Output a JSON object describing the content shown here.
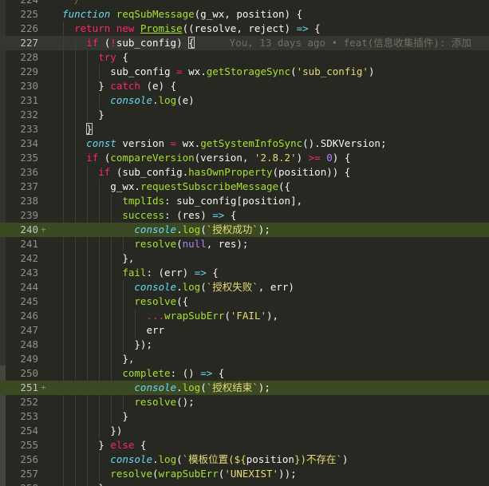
{
  "editor": {
    "blame_text": "You, 13 days ago • feat(信息收集插件): 添加",
    "colors": {
      "background": "#272822",
      "added_line": "#3b4a22",
      "keyword": "#f92672",
      "storage": "#66d9ef",
      "function_name": "#a6e22e",
      "string": "#e6db74",
      "number": "#ae81ff",
      "comment": "#75715e"
    },
    "lines": [
      {
        "num": "224",
        "indent": 2,
        "marker": "",
        "toks": [
          [
            "m",
            " */"
          ]
        ]
      },
      {
        "num": "225",
        "indent": 2,
        "marker": "",
        "toks": [
          [
            "c",
            "function"
          ],
          [
            "",
            " "
          ],
          [
            "f",
            "reqSubMessage"
          ],
          [
            "",
            "(g_wx, position) {"
          ]
        ]
      },
      {
        "num": "226",
        "indent": 4,
        "marker": "",
        "toks": [
          [
            "k",
            "return"
          ],
          [
            "",
            " "
          ],
          [
            "k",
            "new"
          ],
          [
            "",
            " "
          ],
          [
            "fu",
            "Promise"
          ],
          [
            "",
            "((resolve, reject) "
          ],
          [
            "c",
            "=>"
          ],
          [
            "",
            " {"
          ]
        ]
      },
      {
        "num": "227",
        "indent": 6,
        "marker": "",
        "cls": "cur",
        "blame": true,
        "toks": [
          [
            "k",
            "if"
          ],
          [
            "",
            " ("
          ],
          [
            "k",
            "!"
          ],
          [
            "",
            "sub_config) "
          ],
          [
            "bx",
            "{"
          ]
        ]
      },
      {
        "num": "228",
        "indent": 8,
        "marker": "",
        "toks": [
          [
            "k",
            "try"
          ],
          [
            "",
            " {"
          ]
        ]
      },
      {
        "num": "229",
        "indent": 10,
        "marker": "",
        "toks": [
          [
            "",
            "sub_config "
          ],
          [
            "k",
            "="
          ],
          [
            "",
            " wx."
          ],
          [
            "f",
            "getStorageSync"
          ],
          [
            "",
            "("
          ],
          [
            "t",
            "'sub_config'"
          ],
          [
            "",
            ")"
          ]
        ]
      },
      {
        "num": "230",
        "indent": 8,
        "marker": "",
        "toks": [
          [
            "",
            "} "
          ],
          [
            "k",
            "catch"
          ],
          [
            "",
            " (e) {"
          ]
        ]
      },
      {
        "num": "231",
        "indent": 10,
        "marker": "",
        "toks": [
          [
            "c",
            "console"
          ],
          [
            "",
            "."
          ],
          [
            "f",
            "log"
          ],
          [
            "",
            "(e)"
          ]
        ]
      },
      {
        "num": "232",
        "indent": 8,
        "marker": "",
        "toks": [
          [
            "",
            "}"
          ]
        ]
      },
      {
        "num": "233",
        "indent": 6,
        "marker": "",
        "toks": [
          [
            "bx",
            "}"
          ]
        ]
      },
      {
        "num": "234",
        "indent": 6,
        "marker": "",
        "toks": [
          [
            "c",
            "const"
          ],
          [
            "",
            " version "
          ],
          [
            "k",
            "="
          ],
          [
            "",
            " wx."
          ],
          [
            "f",
            "getSystemInfoSync"
          ],
          [
            "",
            "().SDKVersion;"
          ]
        ]
      },
      {
        "num": "235",
        "indent": 6,
        "marker": "",
        "toks": [
          [
            "k",
            "if"
          ],
          [
            "",
            " ("
          ],
          [
            "f",
            "compareVersion"
          ],
          [
            "",
            "(version, "
          ],
          [
            "t",
            "'2.8.2'"
          ],
          [
            "",
            ") "
          ],
          [
            "k",
            ">="
          ],
          [
            "",
            " "
          ],
          [
            "n",
            "0"
          ],
          [
            "",
            ") {"
          ]
        ]
      },
      {
        "num": "236",
        "indent": 8,
        "marker": "",
        "toks": [
          [
            "k",
            "if"
          ],
          [
            "",
            " (sub_config."
          ],
          [
            "f",
            "hasOwnProperty"
          ],
          [
            "",
            "(position)) {"
          ]
        ]
      },
      {
        "num": "237",
        "indent": 10,
        "marker": "",
        "toks": [
          [
            "",
            "g_wx."
          ],
          [
            "f",
            "requestSubscribeMessage"
          ],
          [
            "",
            "({"
          ]
        ]
      },
      {
        "num": "238",
        "indent": 12,
        "marker": "",
        "toks": [
          [
            "f",
            "tmplIds"
          ],
          [
            "",
            ": sub_config[position],"
          ]
        ]
      },
      {
        "num": "239",
        "indent": 12,
        "marker": "",
        "toks": [
          [
            "f",
            "success"
          ],
          [
            "",
            ": (res) "
          ],
          [
            "c",
            "=>"
          ],
          [
            "",
            " {"
          ]
        ]
      },
      {
        "num": "240",
        "indent": 14,
        "marker": "+",
        "cls": "hl",
        "toks": [
          [
            "c",
            "console"
          ],
          [
            "",
            "."
          ],
          [
            "f",
            "log"
          ],
          [
            "",
            "("
          ],
          [
            "t",
            "`授权成功`"
          ],
          [
            "",
            ");"
          ]
        ]
      },
      {
        "num": "241",
        "indent": 14,
        "marker": "",
        "toks": [
          [
            "f",
            "resolve"
          ],
          [
            "",
            "("
          ],
          [
            "n",
            "null"
          ],
          [
            "",
            ", res);"
          ]
        ]
      },
      {
        "num": "242",
        "indent": 12,
        "marker": "",
        "toks": [
          [
            "",
            "},"
          ]
        ]
      },
      {
        "num": "243",
        "indent": 12,
        "marker": "",
        "toks": [
          [
            "f",
            "fail"
          ],
          [
            "",
            ": (err) "
          ],
          [
            "c",
            "=>"
          ],
          [
            "",
            " {"
          ]
        ]
      },
      {
        "num": "244",
        "indent": 14,
        "marker": "",
        "toks": [
          [
            "c",
            "console"
          ],
          [
            "",
            "."
          ],
          [
            "f",
            "log"
          ],
          [
            "",
            "("
          ],
          [
            "t",
            "`授权失败`"
          ],
          [
            "",
            ", err)"
          ]
        ]
      },
      {
        "num": "245",
        "indent": 14,
        "marker": "",
        "toks": [
          [
            "f",
            "resolve"
          ],
          [
            "",
            "({"
          ]
        ]
      },
      {
        "num": "246",
        "indent": 16,
        "marker": "",
        "toks": [
          [
            "k",
            "..."
          ],
          [
            "f",
            "wrapSubErr"
          ],
          [
            "",
            "("
          ],
          [
            "t",
            "'FAIL'"
          ],
          [
            "",
            "),"
          ]
        ]
      },
      {
        "num": "247",
        "indent": 16,
        "marker": "",
        "toks": [
          [
            "",
            "err"
          ]
        ]
      },
      {
        "num": "248",
        "indent": 14,
        "marker": "",
        "toks": [
          [
            "",
            "});"
          ]
        ]
      },
      {
        "num": "249",
        "indent": 12,
        "marker": "",
        "toks": [
          [
            "",
            "},"
          ]
        ]
      },
      {
        "num": "250",
        "indent": 12,
        "marker": "",
        "toks": [
          [
            "f",
            "complete"
          ],
          [
            "",
            ": () "
          ],
          [
            "c",
            "=>"
          ],
          [
            "",
            " {"
          ]
        ]
      },
      {
        "num": "251",
        "indent": 14,
        "marker": "+",
        "cls": "hl",
        "toks": [
          [
            "c",
            "console"
          ],
          [
            "",
            "."
          ],
          [
            "f",
            "log"
          ],
          [
            "",
            "("
          ],
          [
            "t",
            "`授权结束`"
          ],
          [
            "",
            ");"
          ]
        ]
      },
      {
        "num": "252",
        "indent": 14,
        "marker": "",
        "toks": [
          [
            "f",
            "resolve"
          ],
          [
            "",
            "();"
          ]
        ]
      },
      {
        "num": "253",
        "indent": 12,
        "marker": "",
        "toks": [
          [
            "",
            "}"
          ]
        ]
      },
      {
        "num": "254",
        "indent": 10,
        "marker": "",
        "toks": [
          [
            "",
            "})"
          ]
        ]
      },
      {
        "num": "255",
        "indent": 8,
        "marker": "",
        "toks": [
          [
            "",
            "} "
          ],
          [
            "k",
            "else"
          ],
          [
            "",
            " {"
          ]
        ]
      },
      {
        "num": "256",
        "indent": 10,
        "marker": "",
        "toks": [
          [
            "c",
            "console"
          ],
          [
            "",
            "."
          ],
          [
            "f",
            "log"
          ],
          [
            "",
            "("
          ],
          [
            "t",
            "`模板位置(${"
          ],
          [
            "",
            "position"
          ],
          [
            "t",
            "})不存在`"
          ],
          [
            "",
            ")"
          ]
        ]
      },
      {
        "num": "257",
        "indent": 10,
        "marker": "",
        "toks": [
          [
            "f",
            "resolve"
          ],
          [
            "",
            "("
          ],
          [
            "f",
            "wrapSubErr"
          ],
          [
            "",
            "("
          ],
          [
            "t",
            "'UNEXIST'"
          ],
          [
            "",
            "));"
          ]
        ]
      },
      {
        "num": "258",
        "indent": 8,
        "marker": "",
        "toks": [
          [
            "",
            "}"
          ]
        ]
      }
    ]
  }
}
